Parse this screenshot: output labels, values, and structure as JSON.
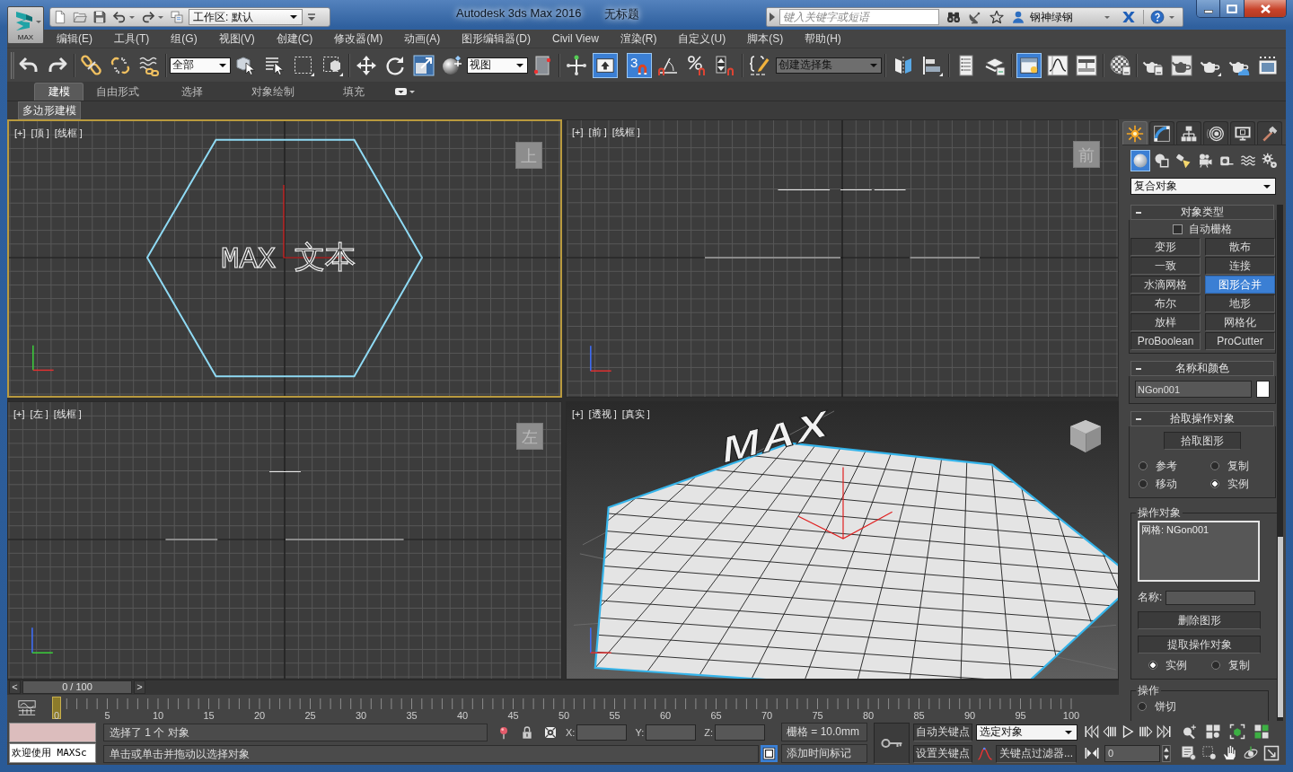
{
  "window": {
    "app_button": "MAX",
    "workspace": "工作区: 默认",
    "title": "Autodesk 3ds Max 2016",
    "document": "无标题",
    "search": {
      "placeholder": "键入关键字或短语"
    },
    "user": "钢神绿钢"
  },
  "menu": [
    "编辑(E)",
    "工具(T)",
    "组(G)",
    "视图(V)",
    "创建(C)",
    "修改器(M)",
    "动画(A)",
    "图形编辑器(D)",
    "Civil View",
    "渲染(R)",
    "自定义(U)",
    "脚本(S)",
    "帮助(H)"
  ],
  "main_toolbar": {
    "selection_filter": "全部",
    "reference_coordinate": "视图",
    "keyboard_override": {
      "on": true
    },
    "snap_toggle": {
      "label": "3",
      "on": true
    },
    "named_selection": "创建选择集",
    "ribbon_toggle": {
      "on": true
    }
  },
  "ribbon": {
    "tabs": [
      {
        "label": "建模",
        "selected": true
      },
      {
        "label": "自由形式",
        "selected": false
      },
      {
        "label": "选择",
        "selected": false
      },
      {
        "label": "对象绘制",
        "selected": false
      },
      {
        "label": "填充",
        "selected": false
      }
    ],
    "panel": "多边形建模"
  },
  "viewports": [
    {
      "kind": "top",
      "labels": [
        "[+]",
        "[顶 ]",
        "[线框 ]"
      ],
      "active": true,
      "view_cube": "上",
      "object_text": "MAX 文本"
    },
    {
      "kind": "front",
      "labels": [
        "[+]",
        "[前 ]",
        "[线框 ]"
      ],
      "active": false,
      "view_cube": "前"
    },
    {
      "kind": "left",
      "labels": [
        "[+]",
        "[左 ]",
        "[线框 ]"
      ],
      "active": false,
      "view_cube": "左"
    },
    {
      "kind": "perspective",
      "labels": [
        "[+]",
        "[透视 ]",
        "[真实 ]"
      ],
      "active": false,
      "object_text": "MAX"
    }
  ],
  "time_slider": {
    "prev": "<",
    "label": "0 / 100",
    "next": ">",
    "level": 0
  },
  "track_bar": {
    "ticks": [
      "0",
      "5",
      "10",
      "15",
      "20",
      "25",
      "30",
      "35",
      "40",
      "45",
      "50",
      "55",
      "60",
      "65",
      "70",
      "75",
      "80",
      "85",
      "90",
      "95",
      "100"
    ],
    "level": 0
  },
  "command_panel": {
    "tabs": [
      {
        "kind": "create",
        "selected": true
      },
      {
        "kind": "modify",
        "selected": false
      },
      {
        "kind": "hierarchy",
        "selected": false
      },
      {
        "kind": "motion",
        "selected": false
      },
      {
        "kind": "display",
        "selected": false
      },
      {
        "kind": "utilities",
        "selected": false
      }
    ],
    "categories": [
      {
        "kind": "geometry",
        "selected": true
      },
      {
        "kind": "shapes",
        "selected": false
      },
      {
        "kind": "lights",
        "selected": false
      },
      {
        "kind": "cameras",
        "selected": false
      },
      {
        "kind": "helpers",
        "selected": false
      },
      {
        "kind": "space_warps",
        "selected": false
      },
      {
        "kind": "systems",
        "selected": false
      }
    ],
    "object_category": "复合对象",
    "rollouts": [
      {
        "kind": "object_type",
        "title": "对象类型",
        "auto_grid": {
          "label": "自动栅格",
          "checked": false
        },
        "buttons": [
          {
            "label": "变形",
            "selected": false
          },
          {
            "label": "散布",
            "selected": false
          },
          {
            "label": "一致",
            "selected": false
          },
          {
            "label": "连接",
            "selected": false
          },
          {
            "label": "水滴网格",
            "selected": false
          },
          {
            "label": "图形合并",
            "selected": true
          },
          {
            "label": "布尔",
            "selected": false
          },
          {
            "label": "地形",
            "selected": false
          },
          {
            "label": "放样",
            "selected": false
          },
          {
            "label": "网格化",
            "selected": false
          },
          {
            "label": "ProBoolean",
            "selected": false
          },
          {
            "label": "ProCutter",
            "selected": false
          }
        ]
      },
      {
        "kind": "name_color",
        "title": "名称和颜色",
        "name": "NGon001",
        "color": "#ffffff"
      },
      {
        "kind": "pick_operand",
        "title": "拾取操作对象",
        "button": "拾取图形",
        "options": [
          {
            "label": "参考",
            "selected": false
          },
          {
            "label": "复制",
            "selected": false
          },
          {
            "label": "移动",
            "selected": false
          },
          {
            "label": "实例",
            "selected": true
          }
        ]
      },
      {
        "kind": "parameters",
        "groups": [
          {
            "kind": "operands",
            "title": "操作对象",
            "items": [
              "网格: NGon001"
            ],
            "name_label": "名称:",
            "buttons": [
              "删除图形",
              "提取操作对象"
            ],
            "options": [
              {
                "label": "实例",
                "selected": true
              },
              {
                "label": "复制",
                "selected": false
              }
            ]
          },
          {
            "kind": "operation",
            "title": "操作",
            "options": [
              {
                "label": "饼切",
                "selected": false
              }
            ]
          }
        ]
      }
    ]
  },
  "status_bar": {
    "listener_output": "欢迎使用 MAXSc",
    "selection": "选择了 1 个 对象",
    "prompt": "单击或单击并拖动以选择对象",
    "coordinates": [
      "X:",
      "Y:",
      "Z:"
    ],
    "grid": "栅格 = 10.0mm",
    "time_tag": "添加时间标记",
    "auto_key": "自动关键点",
    "set_key": "设置关键点",
    "key_set": "选定对象",
    "key_filters": "关键点过滤器...",
    "frame": "0"
  }
}
